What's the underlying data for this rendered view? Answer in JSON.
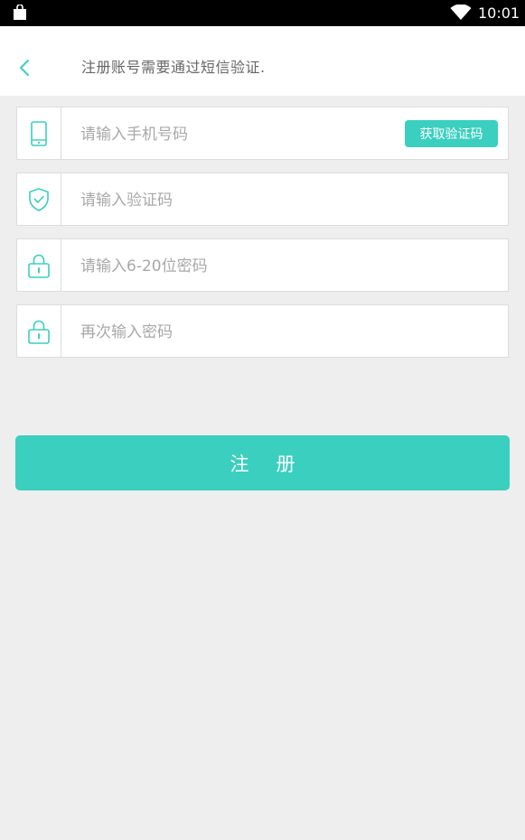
{
  "status_bar": {
    "time": "10:01",
    "icons": [
      "shopping-bag-icon",
      "wifi-icon"
    ]
  },
  "header": {
    "title": "注册账号需要通过短信验证."
  },
  "form": {
    "phone": {
      "placeholder": "请输入手机号码",
      "value": "",
      "icon": "phone-icon"
    },
    "get_code_label": "获取验证码",
    "code": {
      "placeholder": "请输入验证码",
      "value": "",
      "icon": "shield-check-icon"
    },
    "password": {
      "placeholder": "请输入6-20位密码",
      "value": "",
      "icon": "lock-icon"
    },
    "confirm_password": {
      "placeholder": "再次输入密码",
      "value": "",
      "icon": "lock-icon"
    }
  },
  "register_label": "注册",
  "colors": {
    "accent": "#3bcfbf",
    "background": "#eeeeee",
    "icon": "#3bcfbf"
  }
}
